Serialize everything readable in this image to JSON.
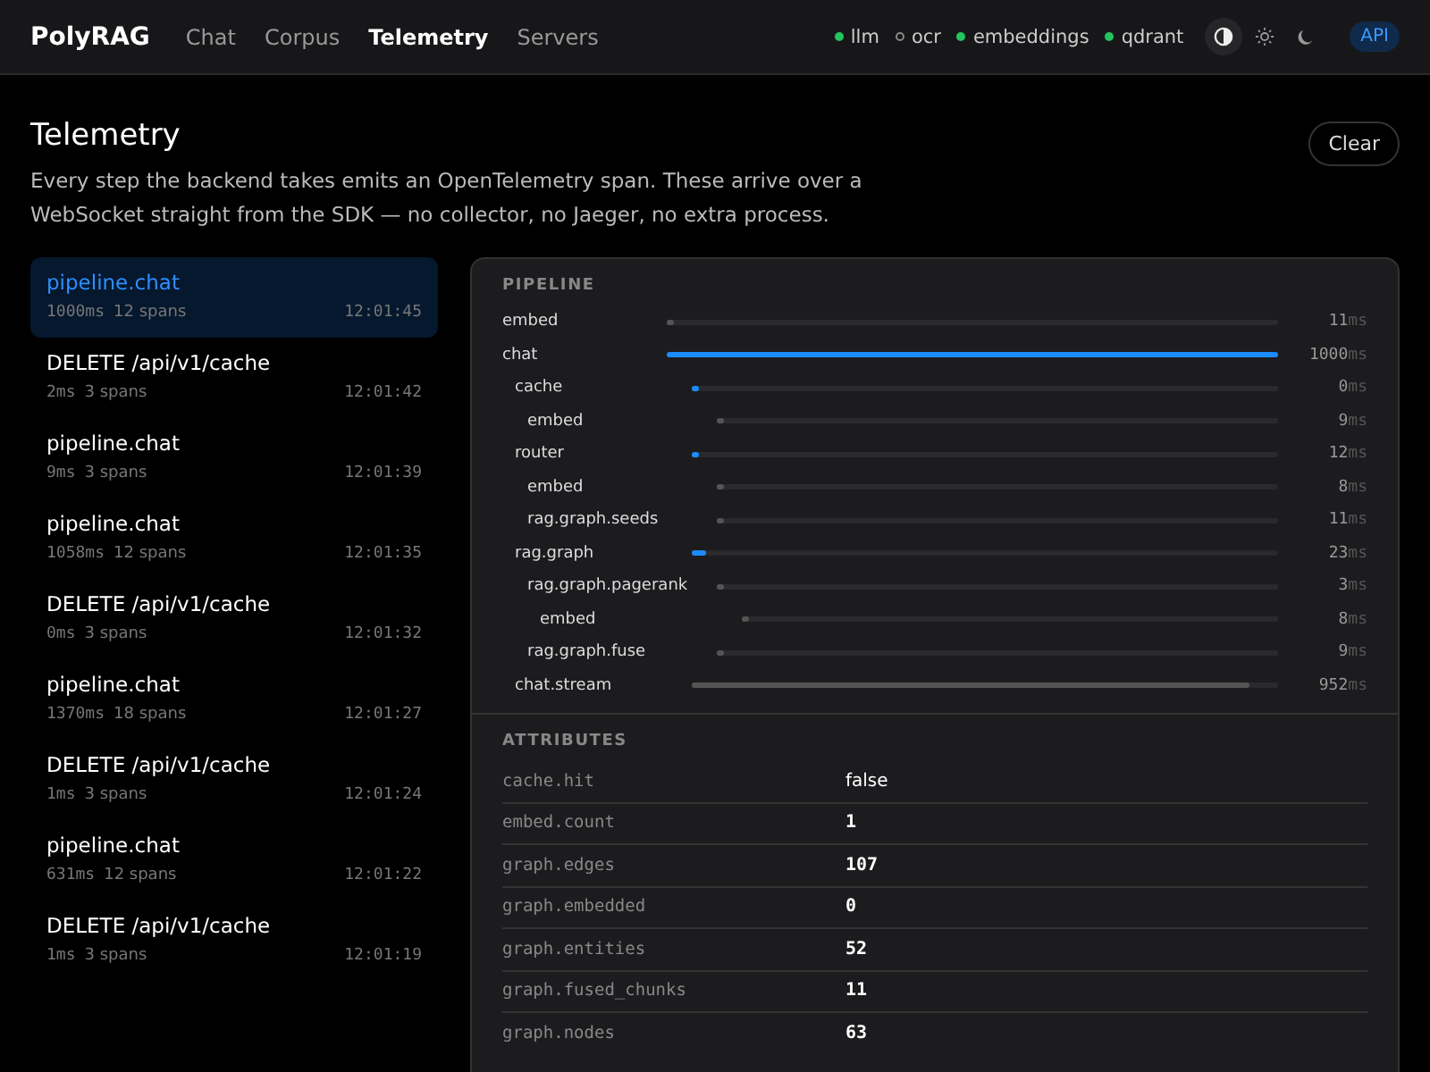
{
  "header": {
    "brand": "PolyRAG",
    "nav": [
      {
        "label": "Chat",
        "selected": false
      },
      {
        "label": "Corpus",
        "selected": false
      },
      {
        "label": "Telemetry",
        "selected": true
      },
      {
        "label": "Servers",
        "selected": false
      }
    ],
    "services": [
      {
        "label": "llm",
        "on": true
      },
      {
        "label": "ocr",
        "on": false
      },
      {
        "label": "embeddings",
        "on": true
      },
      {
        "label": "qdrant",
        "on": true
      }
    ],
    "themes": [
      {
        "kind": "contrast",
        "selected": true
      },
      {
        "kind": "sun",
        "selected": false
      },
      {
        "kind": "moon",
        "selected": false
      }
    ],
    "api_badge": "API"
  },
  "page": {
    "title": "Telemetry",
    "description": "Every step the backend takes emits an OpenTelemetry span. These arrive over a WebSocket straight from the SDK — no collector, no Jaeger, no extra process.",
    "clear_button": "Clear"
  },
  "traces": [
    {
      "name": "pipeline.chat",
      "duration": "1000ms",
      "spans": "12 spans",
      "time": "12:01:45",
      "selected": true
    },
    {
      "name": "DELETE /api/v1/cache",
      "duration": "2ms",
      "spans": "3 spans",
      "time": "12:01:42",
      "selected": false
    },
    {
      "name": "pipeline.chat",
      "duration": "9ms",
      "spans": "3 spans",
      "time": "12:01:39",
      "selected": false
    },
    {
      "name": "pipeline.chat",
      "duration": "1058ms",
      "spans": "12 spans",
      "time": "12:01:35",
      "selected": false
    },
    {
      "name": "DELETE /api/v1/cache",
      "duration": "0ms",
      "spans": "3 spans",
      "time": "12:01:32",
      "selected": false
    },
    {
      "name": "pipeline.chat",
      "duration": "1370ms",
      "spans": "18 spans",
      "time": "12:01:27",
      "selected": false
    },
    {
      "name": "DELETE /api/v1/cache",
      "duration": "1ms",
      "spans": "3 spans",
      "time": "12:01:24",
      "selected": false
    },
    {
      "name": "pipeline.chat",
      "duration": "631ms",
      "spans": "12 spans",
      "time": "12:01:22",
      "selected": false
    },
    {
      "name": "DELETE /api/v1/cache",
      "duration": "1ms",
      "spans": "3 spans",
      "time": "12:01:19",
      "selected": false
    }
  ],
  "pipeline": {
    "title": "PIPELINE",
    "spans": [
      {
        "name": "embed",
        "kind": "muted",
        "level": 0.011,
        "duration": "11",
        "unit": "ms"
      },
      {
        "name": "chat",
        "kind": "accent",
        "level": 1.0,
        "duration": "1000",
        "unit": "ms",
        "children": [
          {
            "name": "cache",
            "kind": "accent",
            "level": 0.0,
            "duration": "0",
            "unit": "ms",
            "children": [
              {
                "name": "embed",
                "kind": "muted",
                "level": 0.009,
                "duration": "9",
                "unit": "ms"
              }
            ]
          },
          {
            "name": "router",
            "kind": "accent",
            "level": 0.012,
            "duration": "12",
            "unit": "ms",
            "children": [
              {
                "name": "embed",
                "kind": "muted",
                "level": 0.008,
                "duration": "8",
                "unit": "ms"
              },
              {
                "name": "rag.graph.seeds",
                "kind": "muted",
                "level": 0.011,
                "duration": "11",
                "unit": "ms"
              }
            ]
          },
          {
            "name": "rag.graph",
            "kind": "accent",
            "level": 0.023,
            "duration": "23",
            "unit": "ms",
            "children": [
              {
                "name": "rag.graph.pagerank",
                "kind": "muted",
                "level": 0.003,
                "duration": "3",
                "unit": "ms",
                "children": [
                  {
                    "name": "embed",
                    "kind": "muted",
                    "level": 0.008,
                    "duration": "8",
                    "unit": "ms"
                  }
                ]
              },
              {
                "name": "rag.graph.fuse",
                "kind": "muted",
                "level": 0.009,
                "duration": "9",
                "unit": "ms"
              }
            ]
          },
          {
            "name": "chat.stream",
            "kind": "muted",
            "level": 0.952,
            "duration": "952",
            "unit": "ms"
          }
        ]
      }
    ]
  },
  "attributes": {
    "title": "ATTRIBUTES",
    "rows": [
      {
        "key": "cache.hit",
        "value": "false",
        "kind": "bool"
      },
      {
        "key": "embed.count",
        "value": "1",
        "kind": "number"
      },
      {
        "key": "graph.edges",
        "value": "107",
        "kind": "number"
      },
      {
        "key": "graph.embedded",
        "value": "0",
        "kind": "number"
      },
      {
        "key": "graph.entities",
        "value": "52",
        "kind": "number"
      },
      {
        "key": "graph.fused_chunks",
        "value": "11",
        "kind": "number"
      },
      {
        "key": "graph.nodes",
        "value": "63",
        "kind": "number"
      }
    ]
  }
}
